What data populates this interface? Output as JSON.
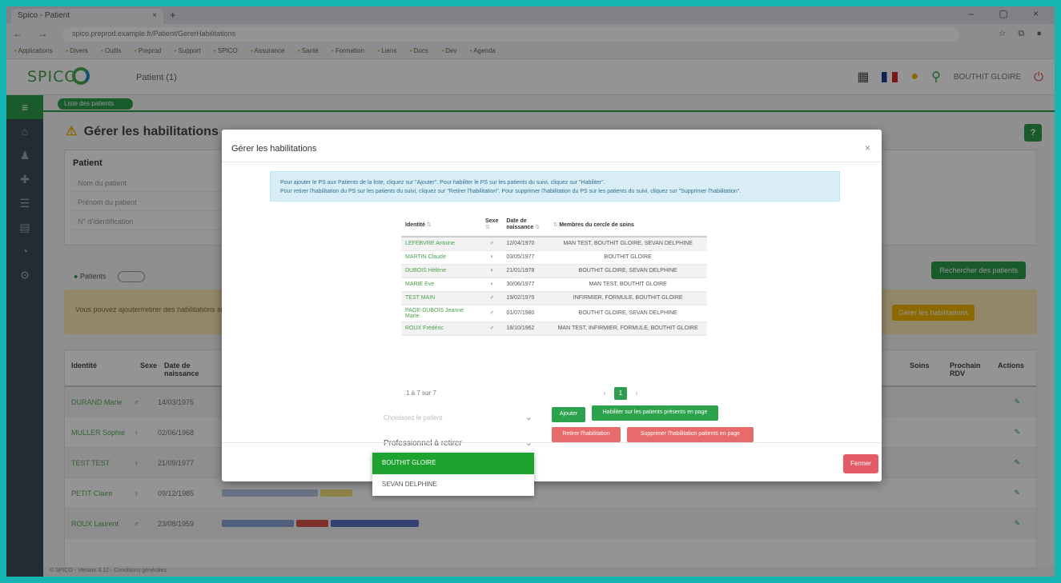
{
  "browser": {
    "tab_title": "Spico - Patient",
    "tab_close": "×",
    "new_tab": "+",
    "window_controls": "– ▢ ×",
    "nav_icons": "← → ⟳",
    "url": "spico.preprod.example.fr/Patient/GererHabilitations",
    "toolbar_icons": "☆ ⧉ ●",
    "bookmarks": [
      "Applications",
      "Divers",
      "Outils",
      "Preprod",
      "Support",
      "SPICO",
      "Assurance",
      "Santé",
      "Formation",
      "Liens",
      "Docs",
      "Dev",
      "Agenda"
    ]
  },
  "app_header": {
    "logo_text": "SPICO",
    "title": "Patient (1)",
    "icons": [
      "▦",
      "●",
      "⚲"
    ],
    "user": "BOUTHIT GLOIRE",
    "logout_icon": "⏻"
  },
  "sidebar": {
    "icons": [
      "≡",
      "⌂",
      "♟",
      "✚",
      "☰",
      "▤",
      "◔",
      "⚙"
    ]
  },
  "page": {
    "breadcrumb": "Liste des patients",
    "title": "Gérer les habilitations",
    "title_icon": "⚠",
    "help": "?",
    "panel_label": "Patient",
    "fields": [
      "Nom du patient",
      "Prénom du patient",
      "N° d'identification"
    ],
    "radio": "Patients",
    "search_button": "Rechercher des patients",
    "warning_text": "Vous pouvez ajouter/retirer des habilitations sur les patients de la liste",
    "warning_button": "Gérer les habilitations",
    "columns": [
      "Identité",
      "Sexe",
      "Date de naissance",
      "Date",
      "Soins",
      "Prochain RDV",
      "Actions"
    ],
    "rows": [
      {
        "id": "DURAND Marie",
        "sex": "♂",
        "dob": "14/03/1975",
        "act": "✎"
      },
      {
        "id": "MULLER Sophie",
        "sex": "♀",
        "dob": "02/06/1968",
        "act": "✎"
      },
      {
        "id": "TEST TEST",
        "sex": "♀",
        "dob": "21/09/1977",
        "act": "✎"
      },
      {
        "id": "PETIT Claire",
        "sex": "♀",
        "dob": "09/12/1985",
        "act": "✎"
      },
      {
        "id": "ROUX Laurent",
        "sex": "♂",
        "dob": "23/08/1959",
        "act": "✎"
      }
    ],
    "status_strip": "© SPICO - Version 3.12 - Conditions générales"
  },
  "modal": {
    "title": "Gérer les habilitations",
    "close": "×",
    "info_line1": "Pour ajouter le PS aux Patients de la liste, cliquez sur \"Ajouter\". Pour habiliter le PS sur les patients du suivi, cliquez sur \"Habiliter\".",
    "info_line2": "Pour retirer l'habilitation du PS sur les patients du suivi, cliquez sur \"Retirer l'habilitation\". Pour supprimer l'habilitation du PS sur les patients du suivi, cliquez sur \"Supprimer l'habilitation\".",
    "table": {
      "headers": {
        "identite": "Identité",
        "sexe": "Sexe",
        "date": "Date de naissance",
        "membres": "Membres du cercle de soins"
      },
      "sort_icon": "⇅",
      "rows": [
        {
          "identite": "LEFEBVRE Antoine",
          "sexe": "♂",
          "sex_class": "sex-m",
          "date": "12/04/1970",
          "membres": "MAN TEST, BOUTHIT GLOIRE, SEVAN DELPHINE"
        },
        {
          "identite": "MARTIN Claude",
          "sexe": "♀",
          "sex_class": "sex-f",
          "date": "03/05/1977",
          "membres": "BOUTHIT GLOIRE"
        },
        {
          "identite": "DUBOIS Hélène",
          "sexe": "♀",
          "sex_class": "sex-f",
          "date": "21/01/1978",
          "membres": "BOUTHIT GLOIRE, SEVAN DELPHINE"
        },
        {
          "identite": "MARIE Eve",
          "sexe": "♀",
          "sex_class": "sex-f",
          "date": "30/06/1977",
          "membres": "MAN TEST, BOUTHIT GLOIRE"
        },
        {
          "identite": "TEST MAIN",
          "sexe": "♂",
          "sex_class": "sex-m",
          "date": "19/02/1970",
          "membres": "INFIRMIER, FORMULE, BOUTHIT GLOIRE"
        },
        {
          "identite": "PAGE-DUBOIS Jeanne Marie",
          "sexe": "♂",
          "sex_class": "sex-m",
          "date": "01/07/1980",
          "membres": "BOUTHIT GLOIRE, SEVAN DELPHINE"
        },
        {
          "identite": "ROUX Frédéric",
          "sexe": "♂",
          "sex_class": "sex-m",
          "date": "18/10/1962",
          "membres": "MAN TEST, INFIRMIER, FORMULE, BOUTHIT GLOIRE"
        }
      ]
    },
    "count_text": "1 à 7 sur 7",
    "pager": [
      "‹",
      "1",
      "›"
    ],
    "select_patient_placeholder": "Choisissez le patient",
    "select_pro_value": "Professionnel à retirer",
    "buttons": {
      "ajouter": "Ajouter",
      "habiliter": "Habiliter sur les patients présents en page",
      "retirer": "Retirer l'habilitation",
      "supprimer": "Supprimer l'habilitation patients en page"
    },
    "fermer": "Fermer"
  },
  "dropdown": {
    "options": [
      "BOUTHIT GLOIRE",
      "SEVAN DELPHINE"
    ],
    "selected_index": 0
  }
}
